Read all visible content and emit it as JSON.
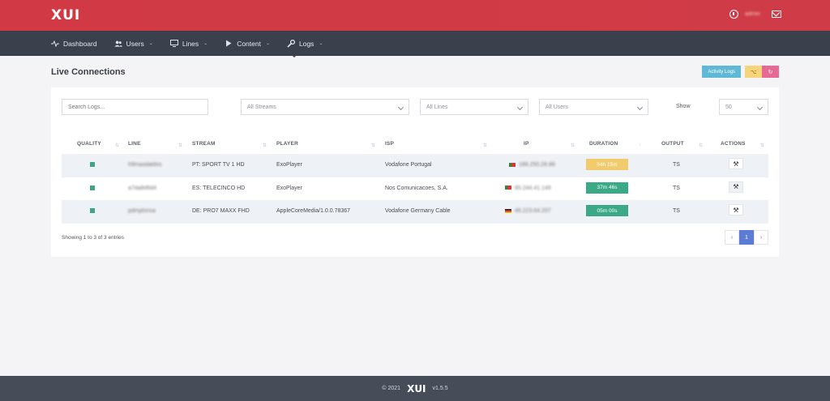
{
  "header": {
    "logo": "XUI",
    "user_name": "admin",
    "mail_icon": "mail-icon"
  },
  "nav": {
    "items": [
      {
        "label": "Dashboard",
        "icon": "activity-icon"
      },
      {
        "label": "Users",
        "icon": "users-icon"
      },
      {
        "label": "Lines",
        "icon": "monitor-icon"
      },
      {
        "label": "Content",
        "icon": "play-icon"
      },
      {
        "label": "Logs",
        "icon": "wrench-icon"
      }
    ]
  },
  "page": {
    "title": "Live Connections",
    "activity_logs_label": "Activity Logs"
  },
  "filters": {
    "search_placeholder": "Search Logs...",
    "streams": "All Streams",
    "lines": "All Lines",
    "users": "All Users",
    "show_label": "Show",
    "show_value": "50"
  },
  "table": {
    "columns": [
      "QUALITY",
      "LINE",
      "STREAM",
      "PLAYER",
      "ISP",
      "IP",
      "DURATION",
      "OUTPUT",
      "ACTIONS"
    ],
    "rows": [
      {
        "line": "h9masdaldos",
        "stream": "PT: SPORT TV 1 HD",
        "player": "ExoPlayer",
        "isp": "Vodafone Portugal",
        "flag": "pt",
        "ip": "188.250.26.88",
        "duration": "54h 15m",
        "duration_color": "#f2cc6c",
        "output": "TS"
      },
      {
        "line": "a7da8d6d4",
        "stream": "ES: TELECINCO HD",
        "player": "ExoPlayer",
        "isp": "Nos Comunicacoes, S.A.",
        "flag": "pt",
        "ip": "85.244.41.149",
        "duration": "37m 46s",
        "duration_color": "#3ba886",
        "output": "TS"
      },
      {
        "line": "pdmjdsnsa",
        "stream": "DE: PRO7 MAXX FHD",
        "player": "AppleCoreMedia/1.0.0.78367",
        "isp": "Vodafone Germany Cable",
        "flag": "de",
        "ip": "46.223.64.207",
        "duration": "05m 00s",
        "duration_color": "#3ba886",
        "output": "TS"
      }
    ]
  },
  "pagination": {
    "summary": "Showing 1 to 3 of 3 entries",
    "prev": "‹",
    "current": "1",
    "next": "›"
  },
  "footer": {
    "copyright": "© 2021",
    "logo": "XUI",
    "version": "v1.5.5"
  }
}
